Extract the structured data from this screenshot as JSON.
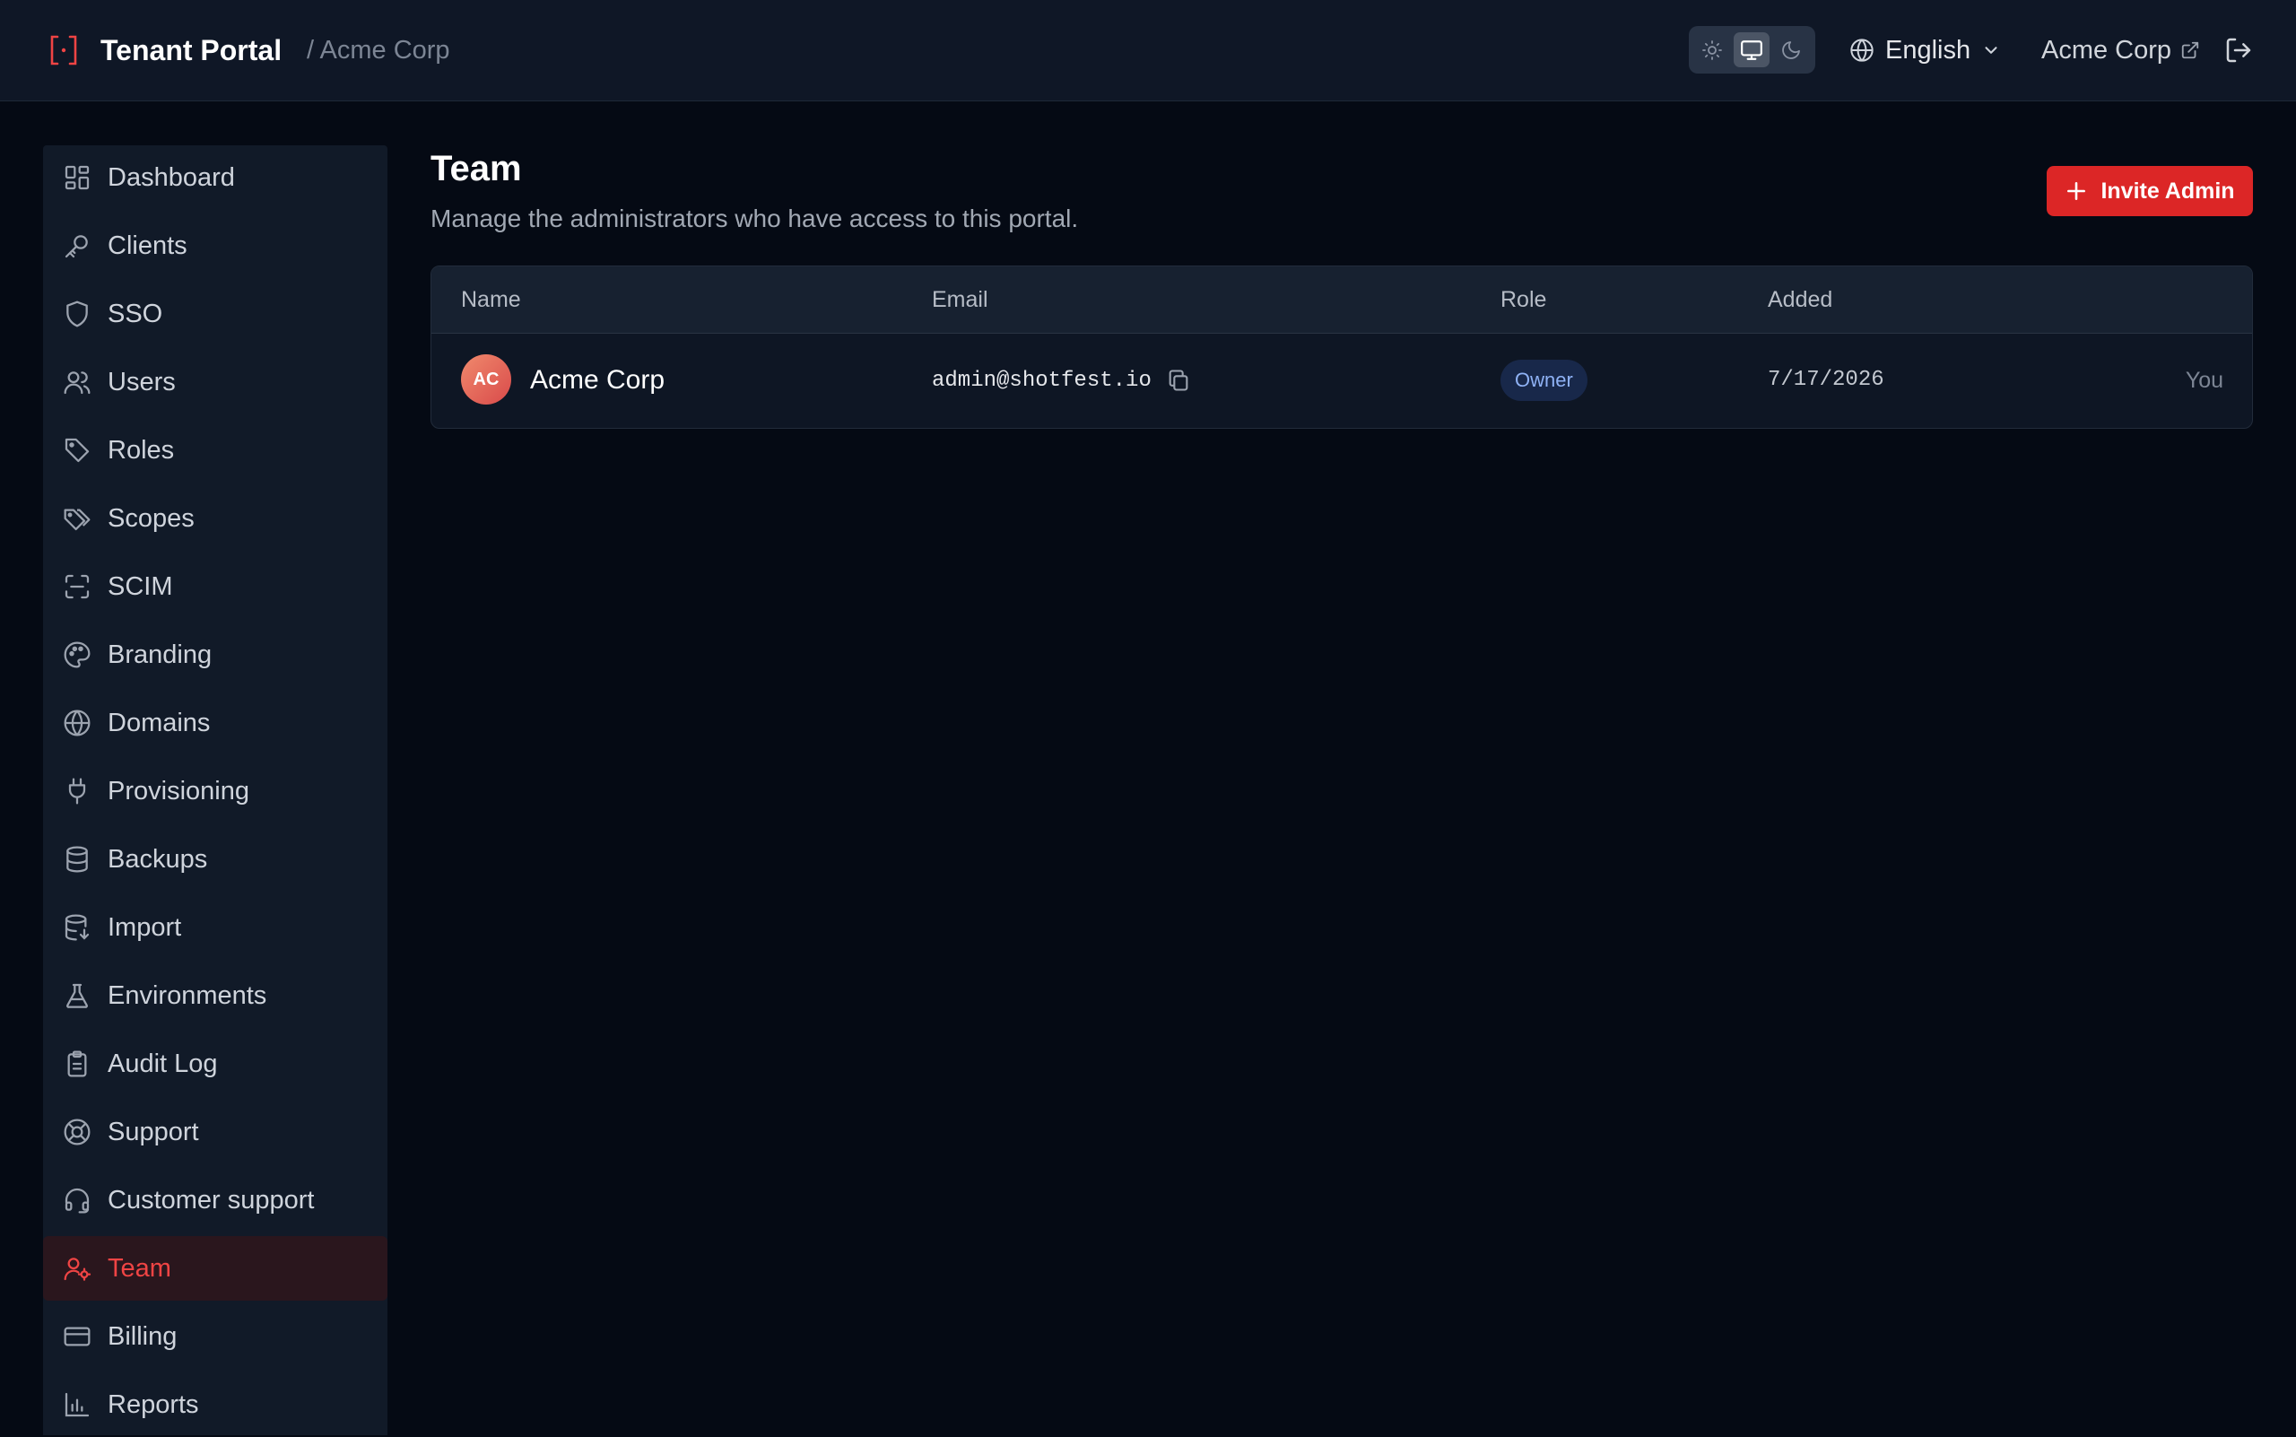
{
  "header": {
    "brand": "Tenant Portal",
    "crumb": "/ Acme Corp",
    "theme": {
      "options": [
        "light",
        "system",
        "dark"
      ],
      "selected": "system"
    },
    "language": "English",
    "account": "Acme Corp"
  },
  "sidebar": {
    "items": [
      {
        "label": "Dashboard",
        "icon": "dashboard-icon"
      },
      {
        "label": "Clients",
        "icon": "key-icon"
      },
      {
        "label": "SSO",
        "icon": "shield-icon"
      },
      {
        "label": "Users",
        "icon": "users-icon"
      },
      {
        "label": "Roles",
        "icon": "tag-icon"
      },
      {
        "label": "Scopes",
        "icon": "tags-icon"
      },
      {
        "label": "SCIM",
        "icon": "scan-icon"
      },
      {
        "label": "Branding",
        "icon": "palette-icon"
      },
      {
        "label": "Domains",
        "icon": "globe-icon"
      },
      {
        "label": "Provisioning",
        "icon": "plug-icon"
      },
      {
        "label": "Backups",
        "icon": "database-icon"
      },
      {
        "label": "Import",
        "icon": "database-import-icon"
      },
      {
        "label": "Environments",
        "icon": "flask-icon"
      },
      {
        "label": "Audit Log",
        "icon": "clipboard-icon"
      },
      {
        "label": "Support",
        "icon": "lifebuoy-icon"
      },
      {
        "label": "Customer support",
        "icon": "headset-icon"
      },
      {
        "label": "Team",
        "icon": "user-cog-icon"
      },
      {
        "label": "Billing",
        "icon": "credit-card-icon"
      },
      {
        "label": "Reports",
        "icon": "bar-chart-icon"
      }
    ],
    "active": "Team"
  },
  "main": {
    "title": "Team",
    "subtitle": "Manage the administrators who have access to this portal.",
    "invite_label": "Invite Admin",
    "table": {
      "columns": [
        "Name",
        "Email",
        "Role",
        "Added"
      ],
      "rows": [
        {
          "initials": "AC",
          "name": "Acme Corp",
          "email": "admin@shotfest.io",
          "role": "Owner",
          "added": "7/17/2026",
          "note": "You"
        }
      ]
    }
  },
  "colors": {
    "accent": "#dc2626",
    "background": "#050a14",
    "sidebar": "#111a28",
    "badge": "#18284a"
  }
}
